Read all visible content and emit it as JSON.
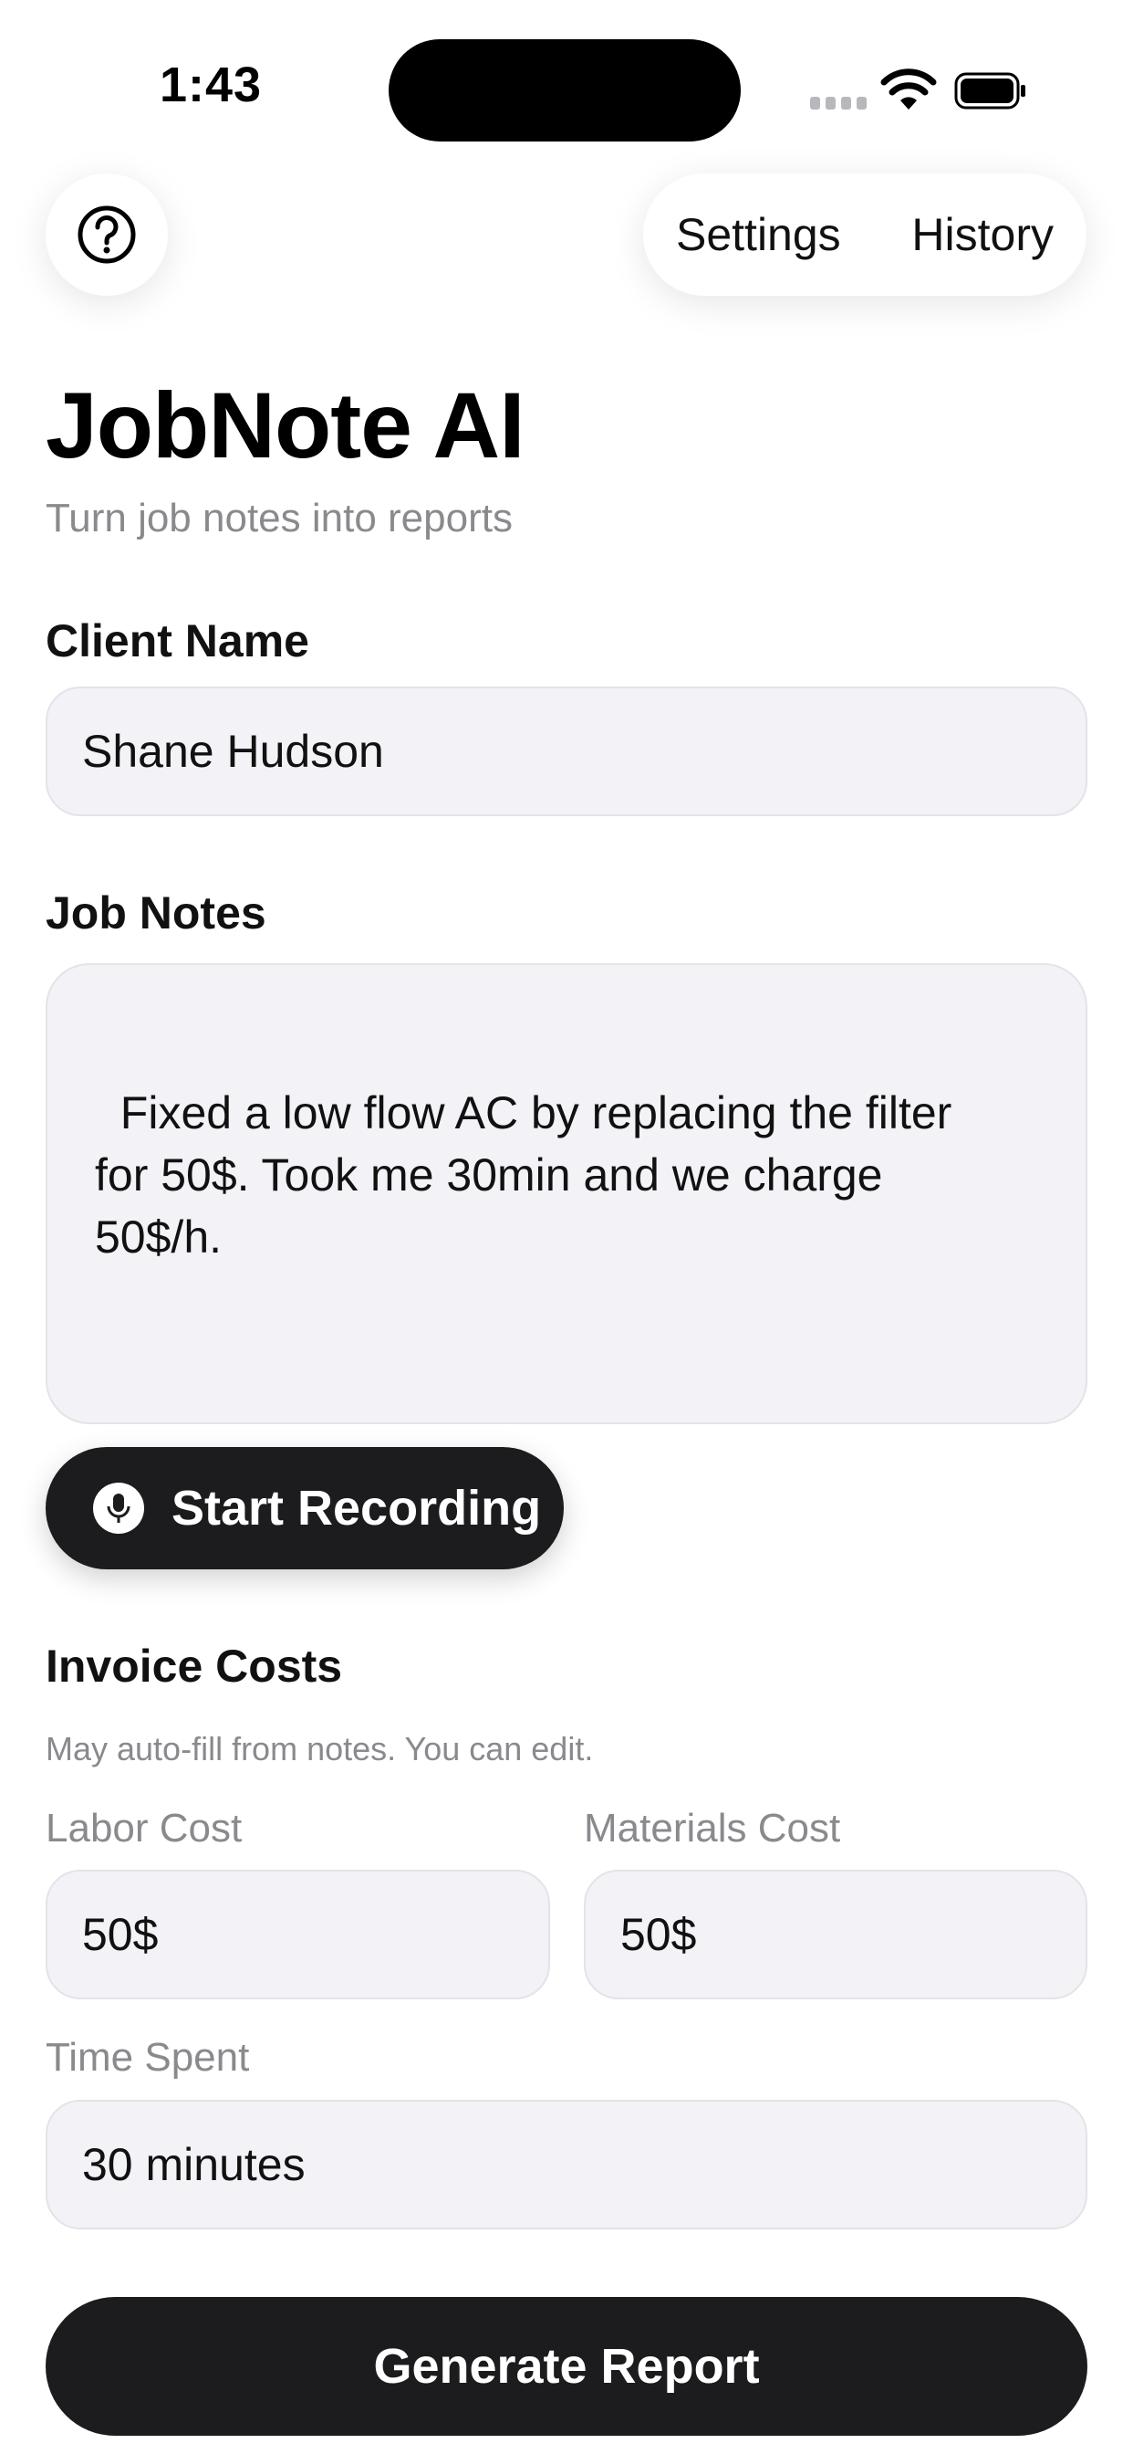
{
  "status_bar": {
    "time": "1:43",
    "wifi_icon": "wifi-icon",
    "battery_icon": "battery-icon"
  },
  "header": {
    "help_icon": "question-circle-icon",
    "settings_label": "Settings",
    "history_label": "History"
  },
  "app": {
    "title": "JobNote AI",
    "subtitle": "Turn job notes into reports"
  },
  "client": {
    "label": "Client Name",
    "value": "Shane Hudson"
  },
  "notes": {
    "label": "Job Notes",
    "value": "Fixed a low flow AC by replacing the filter\nfor 50$. Took me 30min and we charge\n50$/h."
  },
  "recording": {
    "label": "Start Recording",
    "icon": "microphone-icon"
  },
  "invoice": {
    "title": "Invoice Costs",
    "hint": "May auto-fill from notes. You can edit.",
    "labor_label": "Labor Cost",
    "labor_value": "50$",
    "materials_label": "Materials Cost",
    "materials_value": "50$",
    "time_label": "Time Spent",
    "time_value": "30 minutes"
  },
  "actions": {
    "generate_label": "Generate Report"
  },
  "colors": {
    "button_dark": "#1c1c1e",
    "field_bg": "#f2f2f7",
    "secondary_text": "#8a8a8e"
  }
}
